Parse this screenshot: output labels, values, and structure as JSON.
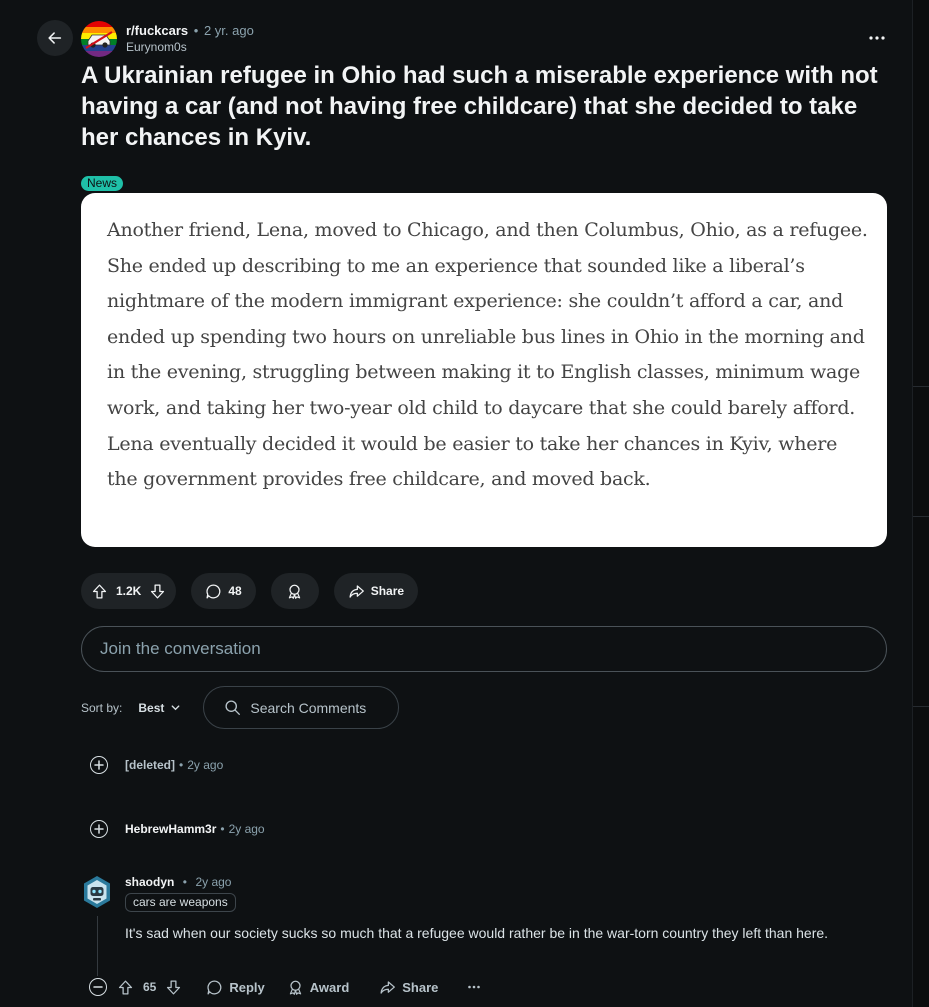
{
  "post": {
    "subreddit": "r/fuckcars",
    "age": "2 yr. ago",
    "author": "Eurynom0s",
    "title": "A Ukrainian refugee in Ohio had such a miserable experience with not having a car (and not having free childcare) that she decided to take her chances in Kyiv.",
    "flair": "News",
    "quote": "Another friend, Lena, moved to Chicago, and then Columbus, Ohio, as a refugee. She ended up describing to me an experience that sounded like a liberal’s nightmare of the modern immigrant experience: she couldn’t afford a car, and ended up spending two hours on unreliable bus lines in Ohio in the morning and in the evening, struggling between making it to English classes, minimum wage work, and taking her two-year old child to daycare that she could barely afford. Lena eventually decided it would be easier to take her chances in Kyiv, where the government provides free childcare, and moved back."
  },
  "actions": {
    "votes": "1.2K",
    "comments": "48",
    "share": "Share"
  },
  "comment_box": {
    "placeholder": "Join the conversation"
  },
  "sort": {
    "label": "Sort by:",
    "value": "Best",
    "search_placeholder": "Search Comments"
  },
  "comments": [
    {
      "user": "[deleted]",
      "age": "2y ago"
    },
    {
      "user": "HebrewHamm3r",
      "age": "2y ago"
    },
    {
      "user": "shaodyn",
      "age": "2y ago",
      "flair": "cars are weapons",
      "body": "It's sad when our society sucks so much that a refugee would rather be in the war-torn country they left than here.",
      "votes": "65",
      "reply": "Reply",
      "award": "Award",
      "share": "Share"
    }
  ],
  "icons": {
    "back": "arrow-left-icon",
    "more": "ellipsis-icon",
    "upvote": "arrow-up-icon",
    "downvote": "arrow-down-icon",
    "comment": "speech-bubble-icon",
    "award": "award-icon",
    "share": "share-arrow-icon",
    "search": "search-icon",
    "expand": "plus-circle-icon",
    "collapse": "minus-circle-icon"
  },
  "colors": {
    "background": "#0e1113",
    "pill": "#1f2326",
    "flair": "#1fc0a8",
    "muted_text": "#8ba2ad"
  }
}
